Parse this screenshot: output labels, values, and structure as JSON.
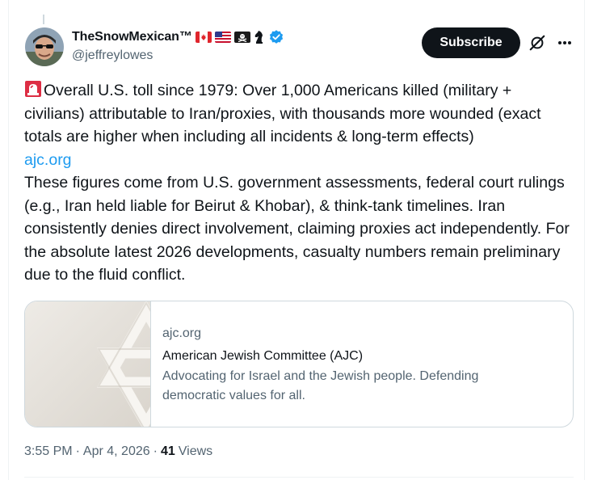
{
  "author": {
    "display_name": "TheSnowMexican™",
    "handle": "@jeffreylowes",
    "badges": [
      "canada-flag-icon",
      "us-flag-icon",
      "pirate-flag-icon",
      "chess-knight-icon",
      "verified-badge-icon"
    ]
  },
  "header": {
    "subscribe_label": "Subscribe"
  },
  "tweet": {
    "paragraph_1": "Overall U.S. toll since 1979: Over 1,000 Americans killed (military + civilians) attributable to Iran/proxies, with thousands more wounded (exact totals are higher when including all incidents & long-term effects)",
    "link_1": "ajc.org",
    "paragraph_2": "These figures come from U.S. government assessments, federal court rulings (e.g., Iran held liable for Beirut & Khobar), & think-tank timelines. Iran consistently denies direct involvement, claiming proxies act independently. For the absolute latest 2026 developments, casualty numbers remain preliminary due to the fluid conflict."
  },
  "card": {
    "domain": "ajc.org",
    "title": "American Jewish Committee (AJC)",
    "description": "Advocating for Israel and the Jewish people. Defending democratic values for all."
  },
  "meta": {
    "time": "3:55 PM",
    "separator": "·",
    "date": "Apr 4, 2026",
    "views_count": "41",
    "views_label": "Views"
  },
  "colors": {
    "accent": "#1d9bf0",
    "text": "#0f1419",
    "secondary": "#536471",
    "border": "#cfd9de"
  }
}
